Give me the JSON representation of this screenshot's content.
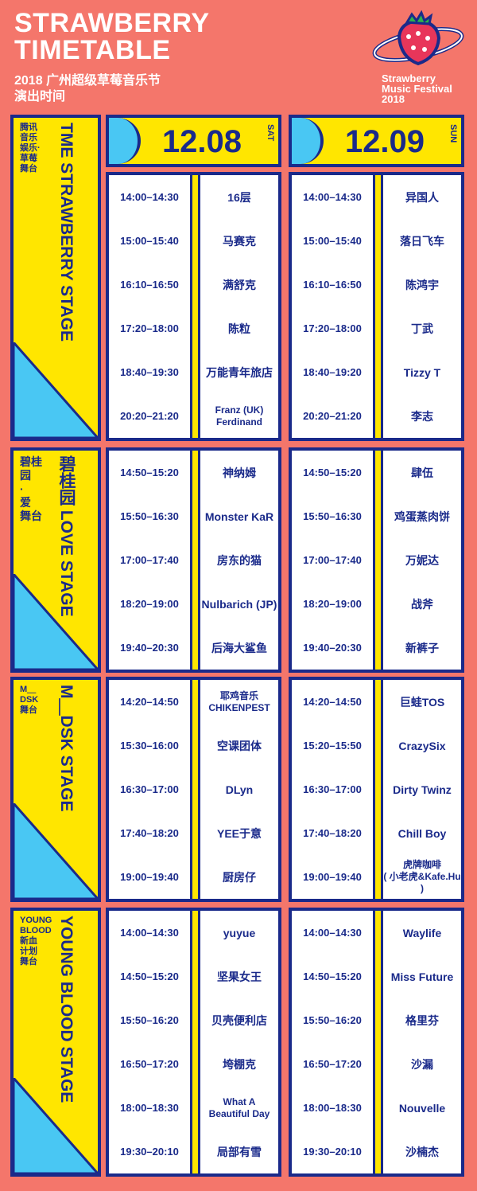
{
  "header": {
    "title": "STRAWBERRY\nTIMETABLE",
    "subtitle": "2018 广州超级草莓音乐节\n演出时间",
    "logo_text": "Strawberry\nMusic Festival\n2018"
  },
  "colors": {
    "background": "#f4766b",
    "yellow": "#ffe600",
    "navy": "#1a2a8a",
    "cyan": "#49c7f3"
  },
  "days": [
    {
      "date": "12.08",
      "dow": "SAT"
    },
    {
      "date": "12.09",
      "dow": "SUN"
    }
  ],
  "stages": [
    {
      "cn": "腾讯\n音乐\n娱乐·\n草莓\n舞台",
      "en": "TME STRAWBERRY STAGE",
      "day1": [
        {
          "time": "14:00–14:30",
          "artist": "16层"
        },
        {
          "time": "15:00–15:40",
          "artist": "马赛克"
        },
        {
          "time": "16:10–16:50",
          "artist": "满舒克"
        },
        {
          "time": "17:20–18:00",
          "artist": "陈粒"
        },
        {
          "time": "18:40–19:30",
          "artist": "万能青年旅店"
        },
        {
          "time": "20:20–21:20",
          "artist": "Franz (UK)\nFerdinand"
        }
      ],
      "day2": [
        {
          "time": "14:00–14:30",
          "artist": "异国人"
        },
        {
          "time": "15:00–15:40",
          "artist": "落日飞车"
        },
        {
          "time": "16:10–16:50",
          "artist": "陈鸿宇"
        },
        {
          "time": "17:20–18:00",
          "artist": "丁武"
        },
        {
          "time": "18:40–19:20",
          "artist": "Tizzy T"
        },
        {
          "time": "20:20–21:20",
          "artist": "李志"
        }
      ]
    },
    {
      "cn": "碧桂园\n·\n爱\n舞台",
      "en": "碧桂园 LOVE STAGE",
      "day1": [
        {
          "time": "14:50–15:20",
          "artist": "神纳姆"
        },
        {
          "time": "15:50–16:30",
          "artist": "Monster KaR"
        },
        {
          "time": "17:00–17:40",
          "artist": "房东的猫"
        },
        {
          "time": "18:20–19:00",
          "artist": "Nulbarich (JP)"
        },
        {
          "time": "19:40–20:30",
          "artist": "后海大鲨鱼"
        }
      ],
      "day2": [
        {
          "time": "14:50–15:20",
          "artist": "肆伍"
        },
        {
          "time": "15:50–16:30",
          "artist": "鸡蛋蒸肉饼"
        },
        {
          "time": "17:00–17:40",
          "artist": "万妮达"
        },
        {
          "time": "18:20–19:00",
          "artist": "战斧"
        },
        {
          "time": "19:40–20:30",
          "artist": "新裤子"
        }
      ]
    },
    {
      "cn": "M＿DSK\n舞台",
      "en": "M＿DSK STAGE",
      "day1": [
        {
          "time": "14:20–14:50",
          "artist": "耶鸡音乐\nCHIKENPEST"
        },
        {
          "time": "15:30–16:00",
          "artist": "空课团体"
        },
        {
          "time": "16:30–17:00",
          "artist": "DLyn"
        },
        {
          "time": "17:40–18:20",
          "artist": "YEE于意"
        },
        {
          "time": "19:00–19:40",
          "artist": "厨房仔"
        }
      ],
      "day2": [
        {
          "time": "14:20–14:50",
          "artist": "巨蛙TOS"
        },
        {
          "time": "15:20–15:50",
          "artist": "CrazySix"
        },
        {
          "time": "16:30–17:00",
          "artist": "Dirty Twinz"
        },
        {
          "time": "17:40–18:20",
          "artist": "Chill Boy"
        },
        {
          "time": "19:00–19:40",
          "artist": "虎牌咖啡\n( 小老虎&Kafe.Hu )"
        }
      ]
    },
    {
      "cn": "YOUNG\nBLOOD\n新血\n计划\n舞台",
      "en": "YOUNG BLOOD STAGE",
      "day1": [
        {
          "time": "14:00–14:30",
          "artist": "yuyue"
        },
        {
          "time": "14:50–15:20",
          "artist": "坚果女王"
        },
        {
          "time": "15:50–16:20",
          "artist": "贝壳便利店"
        },
        {
          "time": "16:50–17:20",
          "artist": "垮棚克"
        },
        {
          "time": "18:00–18:30",
          "artist": "What A\nBeautiful Day"
        },
        {
          "time": "19:30–20:10",
          "artist": "局部有雪"
        }
      ],
      "day2": [
        {
          "time": "14:00–14:30",
          "artist": "Waylife"
        },
        {
          "time": "14:50–15:20",
          "artist": "Miss Future"
        },
        {
          "time": "15:50–16:20",
          "artist": "格里芬"
        },
        {
          "time": "16:50–17:20",
          "artist": "沙漏"
        },
        {
          "time": "18:00–18:30",
          "artist": "Nouvelle"
        },
        {
          "time": "19:30–20:10",
          "artist": "沙楠杰"
        }
      ]
    }
  ]
}
